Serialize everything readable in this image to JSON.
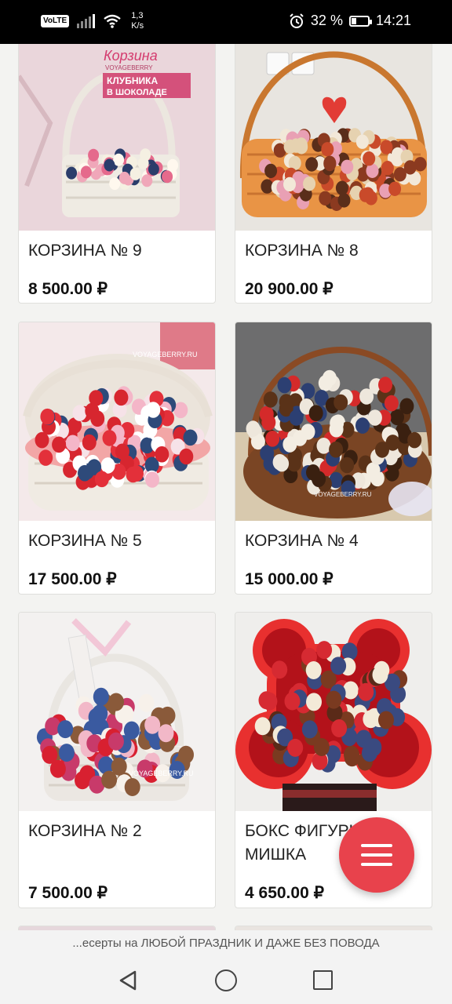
{
  "status_bar": {
    "volte": "VoLTE",
    "net_speed_value": "1,3",
    "net_speed_unit": "K/s",
    "battery_percent": "32 %",
    "battery_level": 0.32,
    "time": "14:21"
  },
  "products": [
    {
      "name": "КОРЗИНА № 9",
      "price": "8 500.00 ₽",
      "image": "strawberry-basket-white"
    },
    {
      "name": "КОРЗИНА № 8",
      "price": "20 900.00 ₽",
      "image": "strawberry-basket-large"
    },
    {
      "name": "КОРЗИНА № 5",
      "price": "17 500.00 ₽",
      "image": "strawberry-basket-pink"
    },
    {
      "name": "КОРЗИНА № 4",
      "price": "15 000.00 ₽",
      "image": "strawberry-basket-blueberry"
    },
    {
      "name": "КОРЗИНА № 2",
      "price": "7 500.00 ₽",
      "image": "strawberry-basket-ribbon"
    },
    {
      "name": "БОКС ФИГУРЫ № 3 МИШКА",
      "price": "4 650.00 ₽",
      "image": "bear-box"
    }
  ],
  "image_text": {
    "korzina_script": "Корзина",
    "voyageberry_small": "VOYAGEBERRY",
    "klubnika_line1": "КЛУБНИКА",
    "klubnika_line2": "В ШОКОЛАДЕ",
    "watermark": "VOYAGEBERRY.RU"
  },
  "ticker_text": "...есерты на ЛЮБОЙ ПРАЗДНИК И ДАЖЕ БЕЗ ПОВОДА",
  "colors": {
    "accent": "#e8424c",
    "background": "#f3f3f1"
  }
}
